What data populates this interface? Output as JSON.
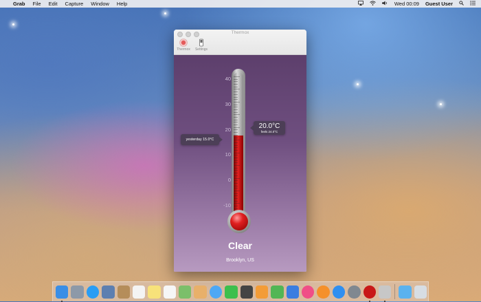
{
  "menubar": {
    "apple_icon": "",
    "app_name": "Grab",
    "menus": [
      "File",
      "Edit",
      "Capture",
      "Window",
      "Help"
    ],
    "clock": "Wed 00:09",
    "user": "Guest User"
  },
  "window": {
    "title": "Thermox",
    "toolbar": {
      "thermox_label": "Thermox",
      "settings_label": "Settings"
    }
  },
  "thermometer": {
    "scale": [
      "40",
      "30",
      "20",
      "10",
      "0",
      "-10"
    ],
    "current_temp": "20.0°C",
    "feels_like": "feels 24.0°C",
    "yesterday": "yesterday 15.0°C",
    "fill_fraction": 0.58
  },
  "weather": {
    "condition": "Clear",
    "location": "Brooklyn, US"
  },
  "dock": {
    "apps": [
      {
        "name": "finder",
        "color": "#3a8ee6"
      },
      {
        "name": "launchpad",
        "color": "#8d99a8"
      },
      {
        "name": "safari",
        "color": "#2a9df4"
      },
      {
        "name": "preview",
        "color": "#5d7fb0"
      },
      {
        "name": "contacts",
        "color": "#b58d5a"
      },
      {
        "name": "calendar",
        "color": "#f4f4f4"
      },
      {
        "name": "notes",
        "color": "#f7e27a"
      },
      {
        "name": "reminders",
        "color": "#f6f6f6"
      },
      {
        "name": "maps",
        "color": "#7bbf6a"
      },
      {
        "name": "photos",
        "color": "#e8b06a"
      },
      {
        "name": "messages",
        "color": "#4ea8f5"
      },
      {
        "name": "facetime",
        "color": "#3cbf4d"
      },
      {
        "name": "photo-booth",
        "color": "#444"
      },
      {
        "name": "pages",
        "color": "#f39c37"
      },
      {
        "name": "numbers",
        "color": "#52b655"
      },
      {
        "name": "keynote",
        "color": "#3b7de0"
      },
      {
        "name": "itunes",
        "color": "#f04e87"
      },
      {
        "name": "ibooks",
        "color": "#f5902a"
      },
      {
        "name": "app-store",
        "color": "#2f8ff0"
      },
      {
        "name": "system-preferences",
        "color": "#808890"
      },
      {
        "name": "thermox",
        "color": "#c81818"
      },
      {
        "name": "grab",
        "color": "#c7c7c7"
      }
    ],
    "folders": [
      {
        "name": "downloads-folder",
        "color": "#5ab2ef"
      },
      {
        "name": "trash",
        "color": "#d7dde3"
      }
    ]
  }
}
